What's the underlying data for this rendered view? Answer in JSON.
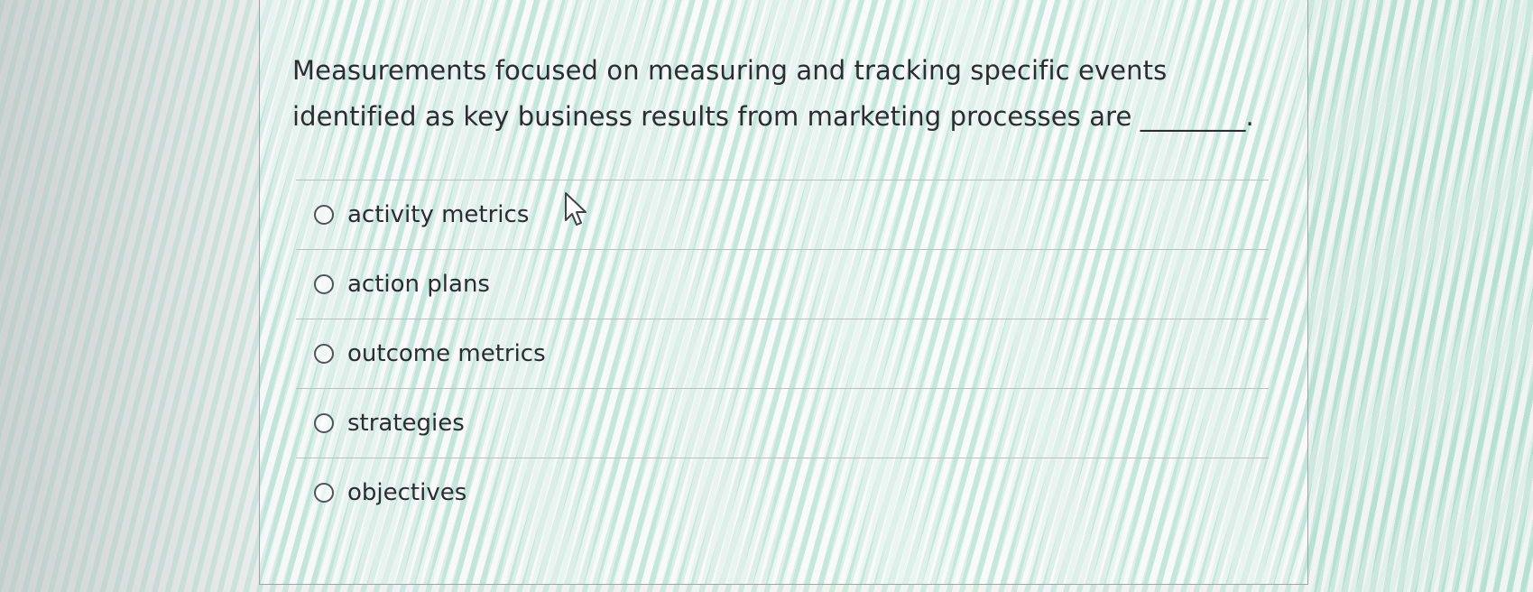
{
  "question": {
    "text": "Measurements focused on measuring and tracking specific events identified as key business results from marketing processes are ________."
  },
  "options": [
    {
      "label": "activity metrics",
      "selected": false
    },
    {
      "label": "action plans",
      "selected": false
    },
    {
      "label": "outcome metrics",
      "selected": false
    },
    {
      "label": "strategies",
      "selected": false
    },
    {
      "label": "objectives",
      "selected": false
    }
  ],
  "icons": {
    "cursor": "mouse-pointer-arrow"
  }
}
